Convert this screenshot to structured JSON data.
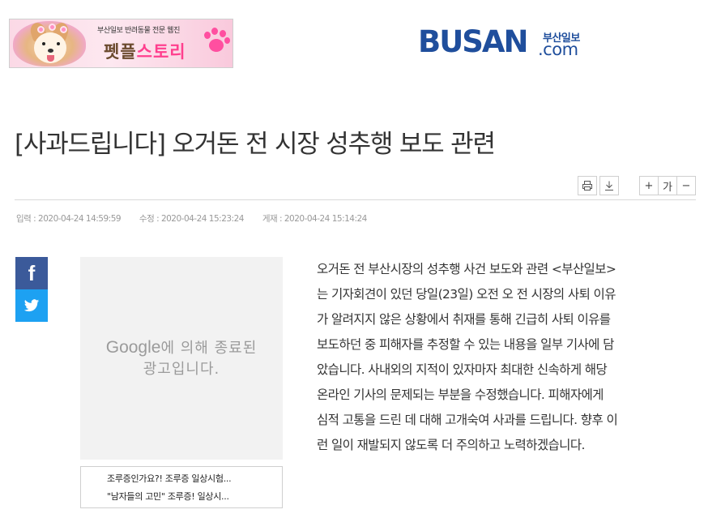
{
  "banner": {
    "tagline": "부산일보 반려동물 전문 웹진",
    "title_part1": "펫플",
    "title_part2": "스토리"
  },
  "logo": {
    "main": "BUSAN",
    "sub": "부산일보",
    "domain": ".com"
  },
  "headline": "[사과드립니다] 오거돈 전 시장 성추행 보도 관련",
  "toolbar": {
    "print_icon": "printer-icon",
    "download_icon": "download-icon",
    "font_plus": "+",
    "font_label": "가",
    "font_minus": "−"
  },
  "dates": {
    "input": "입력 : 2020-04-24 14:59:59",
    "modified": "수정 : 2020-04-24 15:23:24",
    "published": "게재 : 2020-04-24 15:14:24"
  },
  "social": {
    "facebook": "f",
    "twitter_icon": "twitter-bird-icon"
  },
  "ad": {
    "brand": "Google",
    "text1": "에 의해 종료된",
    "text2": "광고입니다."
  },
  "related": [
    "조루증인가요?! 조루증 일상시험...",
    "\"남자들의 고민\" 조루증! 일상시..."
  ],
  "article_lines": [
    "오거돈 전 부산시장의 성추행 사건 보도와 관련 <부산일보>",
    "는 기자회견이 있던 당일(23일) 오전 오 전 시장의 사퇴 이유",
    "가 알려지지 않은 상황에서 취재를 통해 긴급히 사퇴 이유를",
    "보도하던 중 피해자를 추정할 수 있는 내용을 일부 기사에 담",
    "았습니다. 사내외의 지적이 있자마자 최대한 신속하게 해당",
    "온라인 기사의 문제되는 부분을 수정했습니다. 피해자에게",
    "심적 고통을 드린 데 대해 고개숙여 사과를 드립니다. 향후 이",
    "런 일이 재발되지 않도록 더 주의하고 노력하겠습니다."
  ],
  "colors": {
    "brand_blue": "#1f4e9c",
    "facebook": "#3b5a9a",
    "twitter": "#1da1f2",
    "banner_pink": "#ff3f8e"
  }
}
